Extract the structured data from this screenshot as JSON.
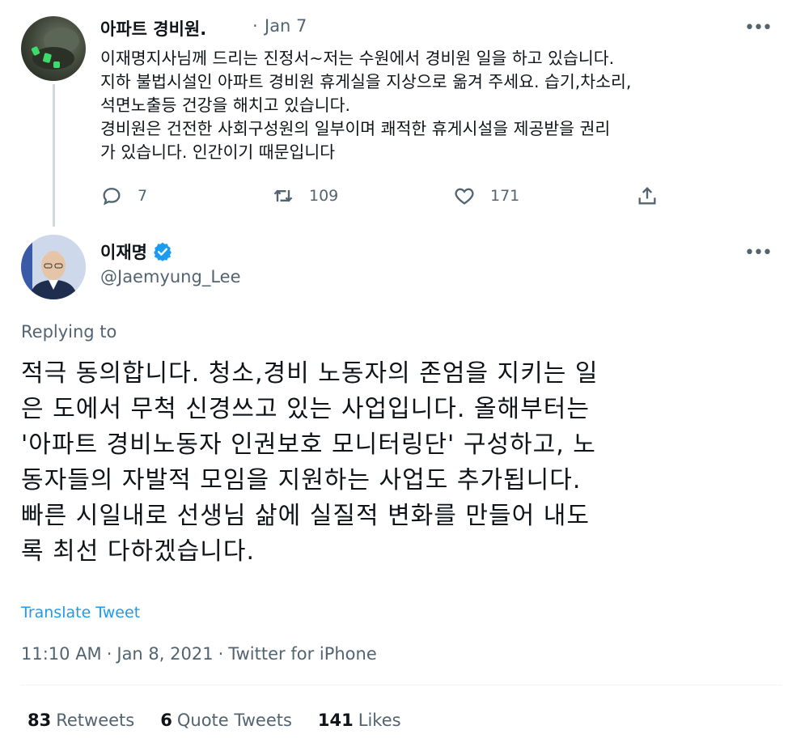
{
  "parent_tweet": {
    "author_name": "아파트 경비원.",
    "separator": "·",
    "date": "Jan 7",
    "more_label": "•••",
    "text_lines": [
      "이재명지사님께 드리는 진정서~저는 수원에서 경비원 일을 하고 있습니다.",
      "지하 불법시설인 아파트 경비원 휴게실을 지상으로 옮겨 주세요. 습기,차소리,",
      "석면노출등 건강을 해치고 있습니다.",
      "경비원은  건전한 사회구성원의 일부이며 쾌적한 휴게시설을 제공받을 권리",
      "가 있습니다. 인간이기 때문입니다"
    ],
    "actions": {
      "replies": "7",
      "retweets": "109",
      "likes": "171"
    },
    "icons": [
      "reply-icon",
      "retweet-icon",
      "like-icon",
      "share-icon"
    ]
  },
  "main_tweet": {
    "author_name": "이재명",
    "handle": "@Jaemyung_Lee",
    "more_label": "•••",
    "replying_label": "Replying to",
    "text_lines": [
      "적극 동의합니다. 청소,경비 노동자의 존엄을 지키는 일",
      "은 도에서 무척 신경쓰고 있는 사업입니다. 올해부터는",
      "'아파트 경비노동자 인권보호 모니터링단' 구성하고, 노",
      "동자들의 자발적 모임을 지원하는 사업도 추가됩니다.",
      "빠른 시일내로 선생님 삶에 실질적 변화를 만들어 내도",
      "록 최선 다하겠습니다."
    ],
    "translate_label": "Translate Tweet",
    "time": "11:10 AM",
    "dot": "·",
    "date": "Jan 8, 2021",
    "source": "Twitter for iPhone",
    "stats": {
      "retweets_count": "83",
      "retweets_label": "Retweets",
      "quotes_count": "6",
      "quotes_label": "Quote Tweets",
      "likes_count": "141",
      "likes_label": "Likes"
    }
  },
  "colors": {
    "text": "#0f1419",
    "secondary": "#536471",
    "accent": "#1d9bf0",
    "thread_line": "#cfd9de"
  }
}
